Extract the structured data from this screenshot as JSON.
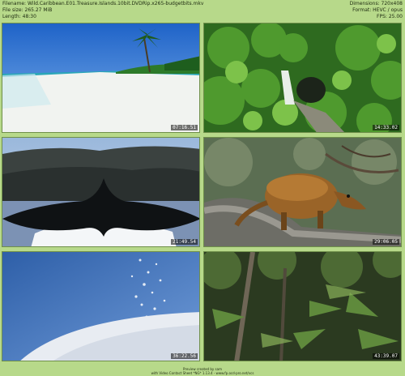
{
  "header": {
    "filename": "Filename: Wild.Caribbean.E01.Treasure.Islands.10bit.DVDRip.x265-budgetbits.mkv",
    "filesize": "File size: 265.27 MiB",
    "length": "Length: 48:30",
    "dimensions": "Dimensions: 720x408",
    "format": "Format: HEVC / opus",
    "fps": "FPS: 25.00"
  },
  "thumbnails": [
    {
      "timestamp": "07:16.51",
      "scene": "beach-with-palm"
    },
    {
      "timestamp": "14:33.02",
      "scene": "jungle-waterfall"
    },
    {
      "timestamp": "21:49.54",
      "scene": "whale-tail"
    },
    {
      "timestamp": "29:06.05",
      "scene": "coati-on-branch"
    },
    {
      "timestamp": "36:22.56",
      "scene": "salt-pile"
    },
    {
      "timestamp": "43:39.07",
      "scene": "rainforest-understory"
    }
  ],
  "footer": {
    "line1": "Preview created by sam",
    "line2": "with Video Contact Sheet *NG* 1.13.4 - www.fp.ocd-pro.net/vcs"
  },
  "colors": {
    "background": "#b7d98a",
    "text": "#1d2a10"
  }
}
